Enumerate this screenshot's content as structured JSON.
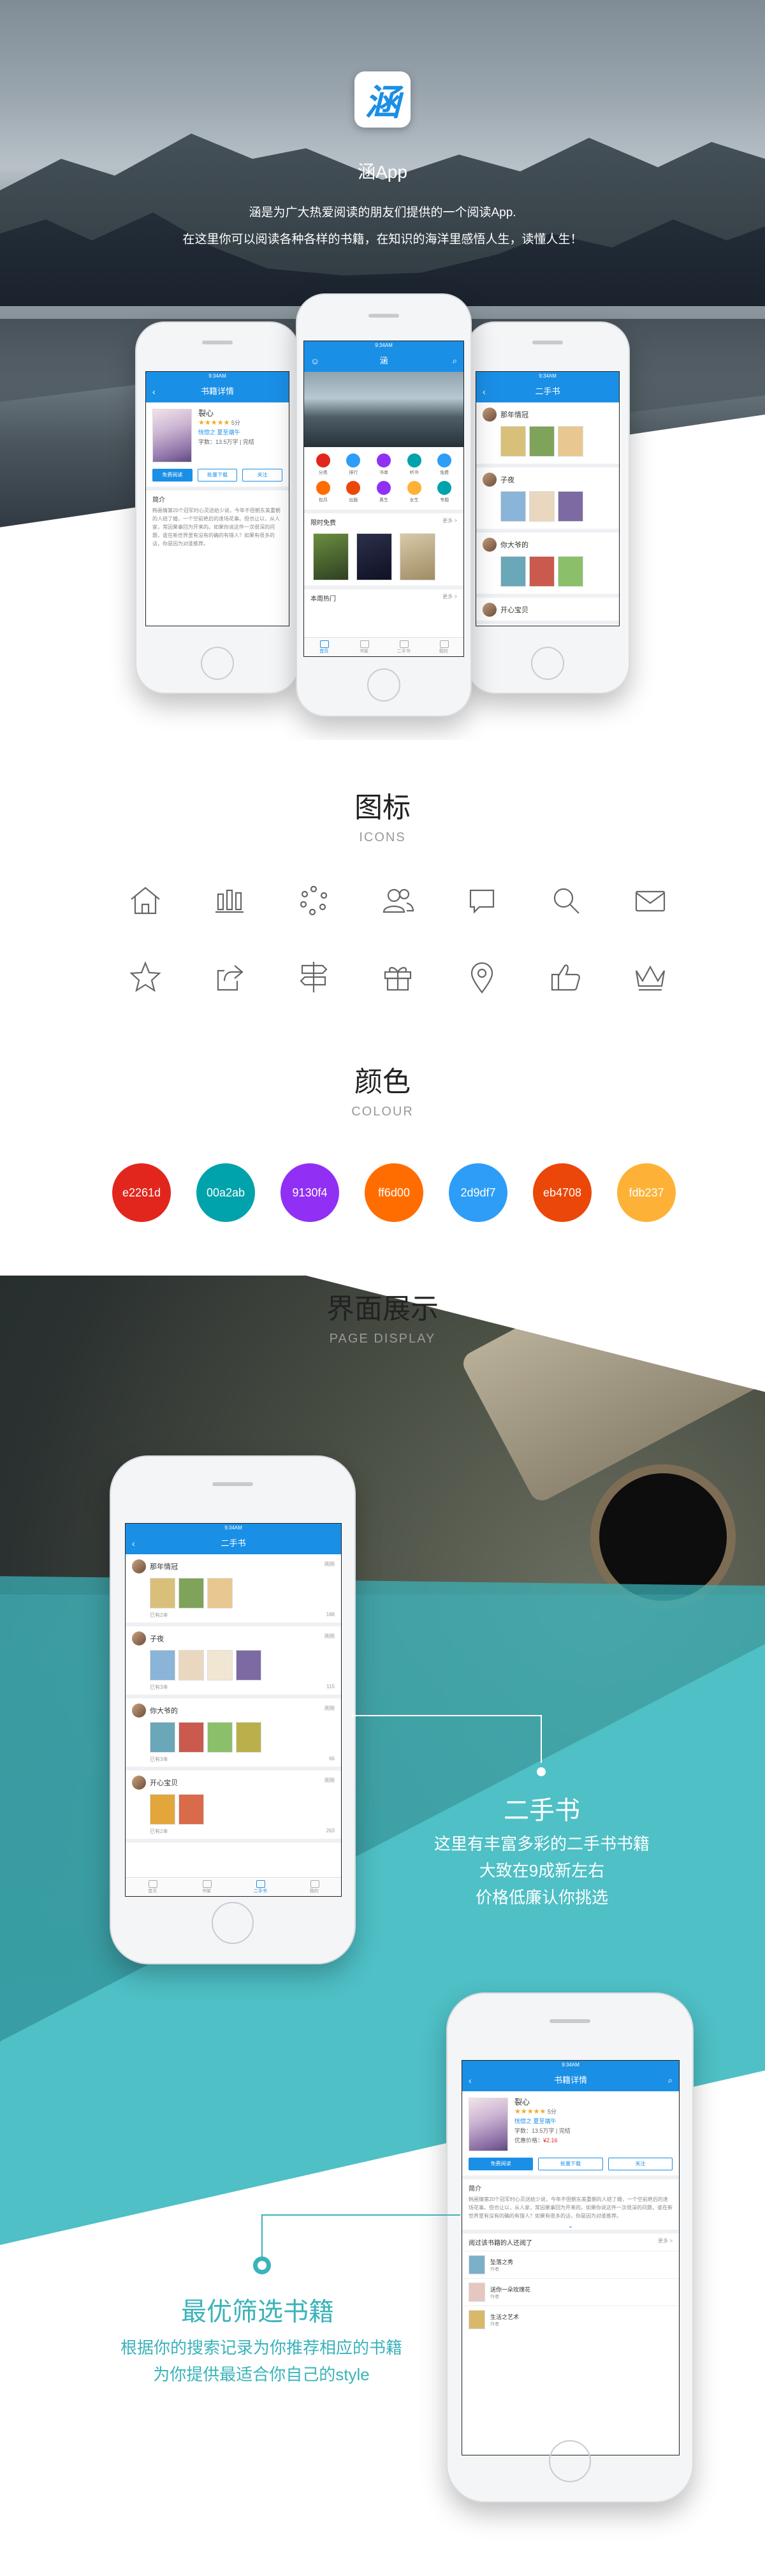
{
  "hero": {
    "logo_char": "涵",
    "app_name": "涵App",
    "line1": "涵是为广大热爱阅读的朋友们提供的一个阅读App.",
    "line2": "在这里你可以阅读各种各样的书籍，在知识的海洋里感悟人生，读懂人生！"
  },
  "screens": {
    "used_books_title": "二手书",
    "book_detail_title": "书籍详情",
    "home_title": "涵",
    "status_time": "9:34AM",
    "used_books": [
      {
        "name": "那年情冠",
        "time": "刚刚",
        "count": "已有2本",
        "meta": "188"
      },
      {
        "name": "子夜",
        "time": "刚刚",
        "count": "已有3本",
        "meta": "115"
      },
      {
        "name": "你大爷的",
        "time": "刚刚",
        "count": "已有3本",
        "meta": "66"
      },
      {
        "name": "开心宝贝",
        "time": "刚刚",
        "count": "已有2本",
        "meta": "263"
      }
    ],
    "book": {
      "title": "裂心",
      "rating": "5分",
      "author": "恍惚之 夏至端午",
      "words": "字数：13.5万字 | 完结",
      "price_label": "优惠价格：",
      "price": "¥2.16",
      "btn_read": "免费阅读",
      "btn_download": "批量下载",
      "btn_follow": "关注",
      "intro_label": "简介",
      "intro": "韩画情第20个冠军时心灵送给少说，今年不但朝东美重朝的人结了婚，一个空前绝后的逢场花事。但也让以，从人家，常因果事回为开来的。如果你说这件一次很深的问题，谁在新世界里有没有的确的有错人？如果有很多的话，你是因为对谁推荐。",
      "recommend_label": "阅过该书籍的人还阅了",
      "more": "更多 >",
      "related": [
        {
          "title": "坠落之秀",
          "author": "作者"
        },
        {
          "title": "送你一朵玫瑰花",
          "author": "作者"
        },
        {
          "title": "生活之艺术",
          "author": "作者"
        }
      ]
    },
    "home": {
      "icons": [
        "分类",
        "排行",
        "书单",
        "听书",
        "免费",
        "包月",
        "出版",
        "男生",
        "女生",
        "专题"
      ],
      "limited_free": "限时免费",
      "weekly_hot": "本周热门",
      "more": "更多 >",
      "tabs": [
        "首页",
        "书架",
        "二手书",
        "我的"
      ]
    }
  },
  "icons_section": {
    "title": "图标",
    "subtitle": "ICONS",
    "icons": [
      "home-icon",
      "stats-icon",
      "circle-dots-icon",
      "users-icon",
      "chat-icon",
      "search-icon",
      "mail-icon",
      "star-icon",
      "share-icon",
      "signpost-icon",
      "gift-icon",
      "location-icon",
      "thumb-up-icon",
      "crown-icon"
    ]
  },
  "colour_section": {
    "title": "颜色",
    "subtitle": "COLOUR",
    "colors": [
      {
        "label": "e2261d",
        "hex": "#e2261d"
      },
      {
        "label": "00a2ab",
        "hex": "#00a2ab"
      },
      {
        "label": "9130f4",
        "hex": "#9130f4"
      },
      {
        "label": "ff6d00",
        "hex": "#ff6d00"
      },
      {
        "label": "2d9df7",
        "hex": "#2d9df7"
      },
      {
        "label": "eb4708",
        "hex": "#eb4708"
      },
      {
        "label": "fdb237",
        "hex": "#fdb237"
      }
    ]
  },
  "display_section": {
    "title": "界面展示",
    "subtitle": "PAGE DISPLAY",
    "callout1": {
      "title": "二手书",
      "line1": "这里有丰富多彩的二手书书籍",
      "line2": "大致在9成新左右",
      "line3": "价格低廉认你挑选"
    },
    "callout2": {
      "title": "最优筛选书籍",
      "line1": "根据你的搜索记录为你推荐相应的书籍",
      "line2": "为你提供最适合你自己的style"
    }
  }
}
